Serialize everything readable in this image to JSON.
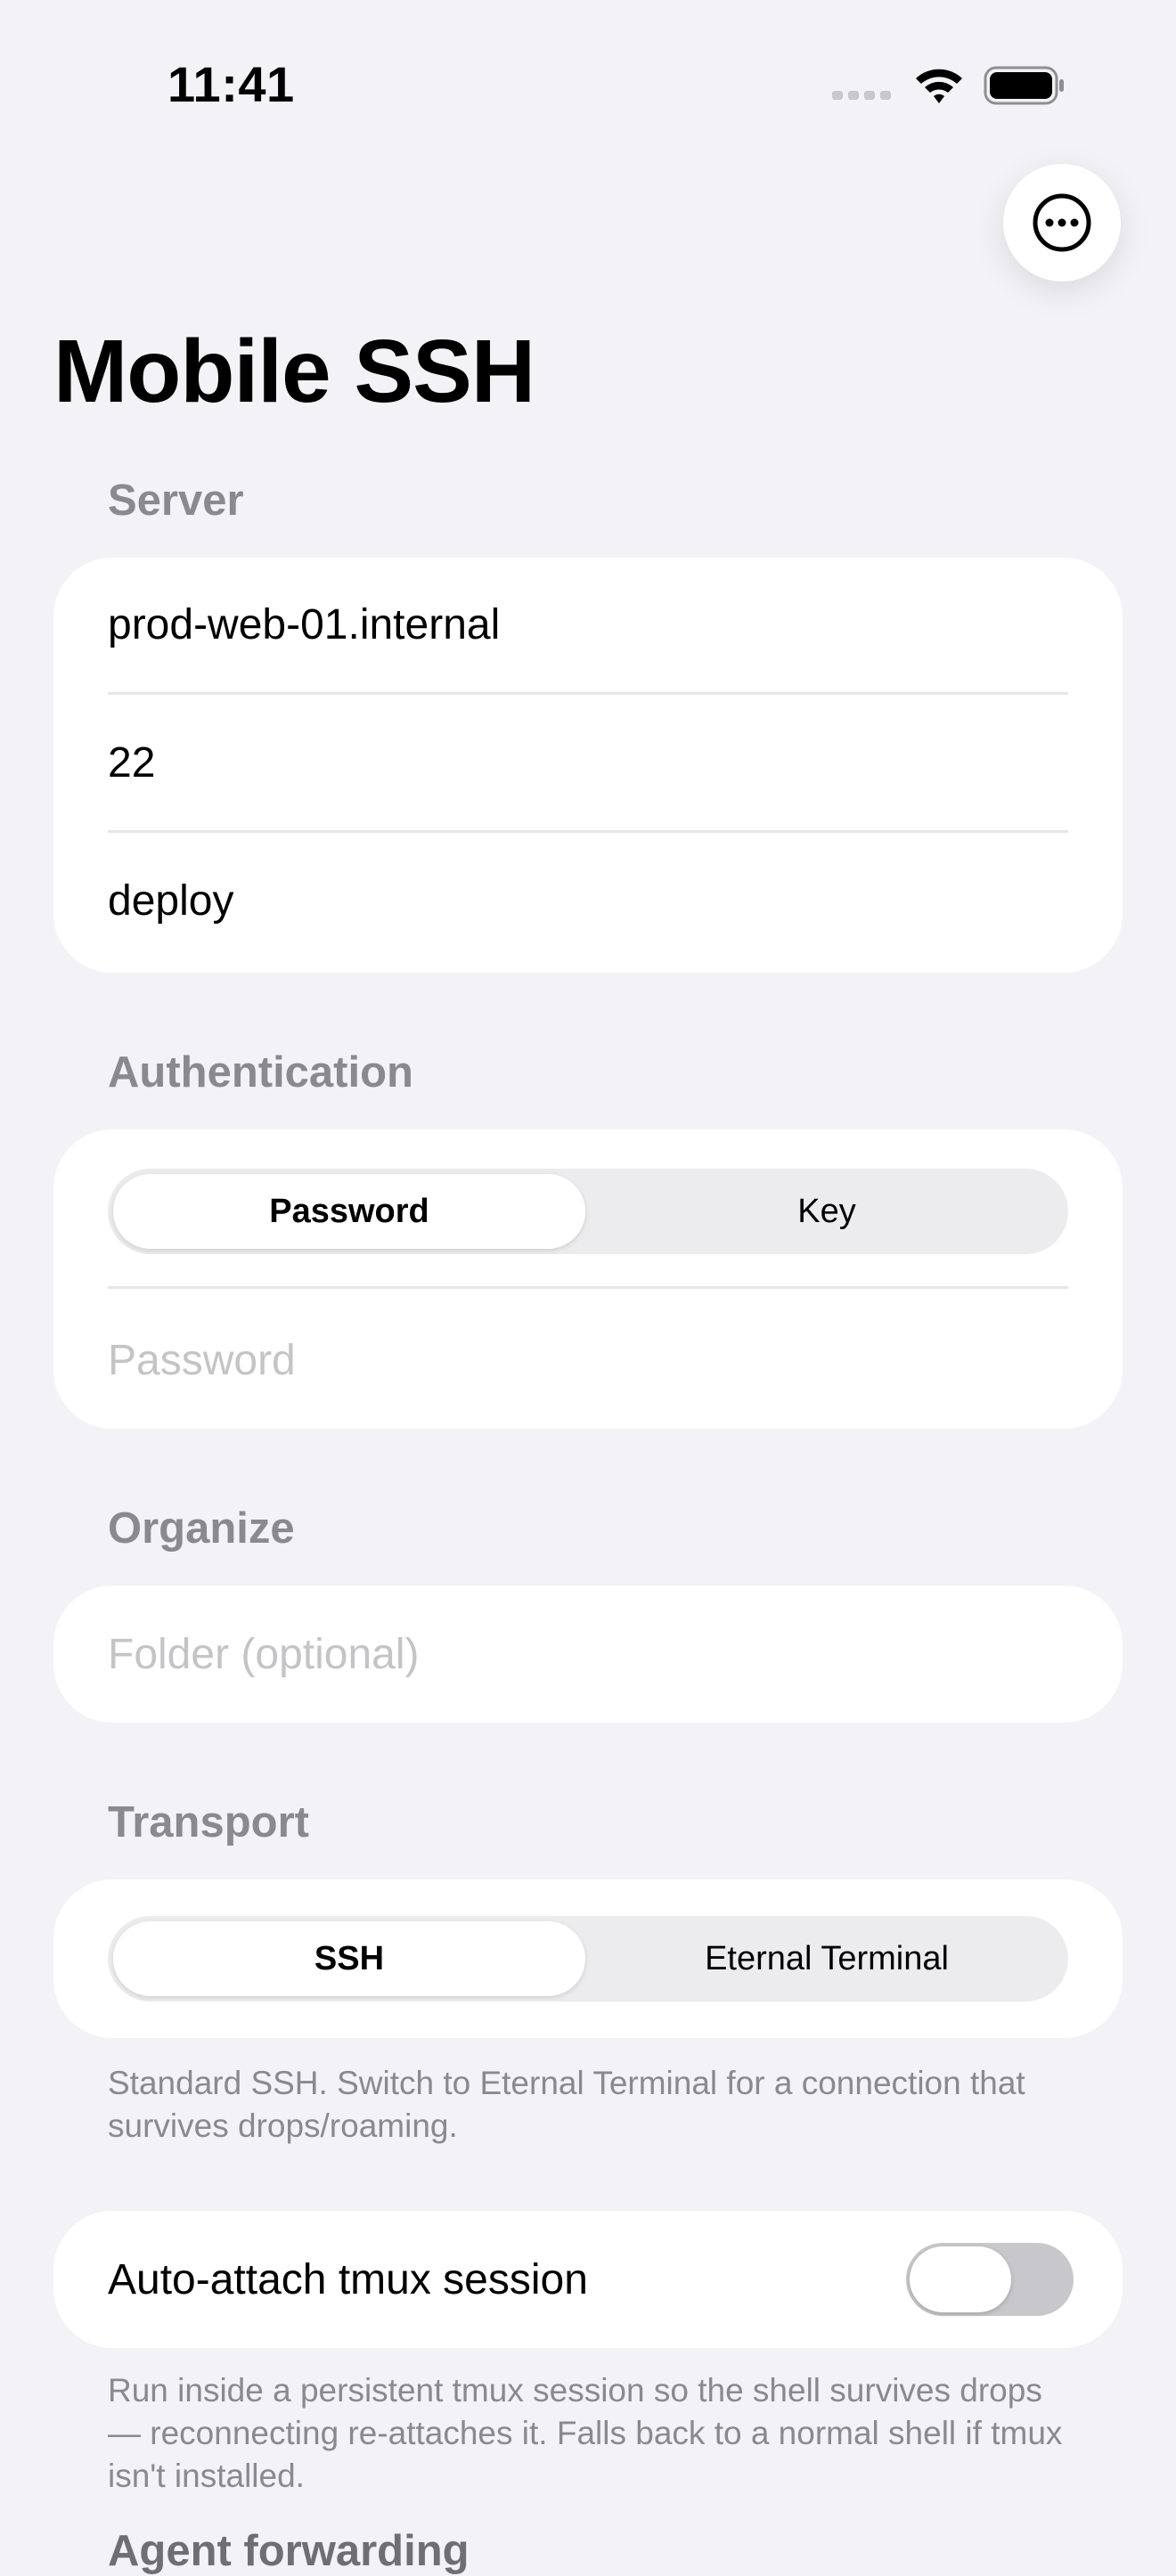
{
  "status_bar": {
    "time": "11:41",
    "icons": [
      "cellular-signal-icon",
      "wifi-icon",
      "battery-icon"
    ]
  },
  "toolbar": {
    "more_icon": "ellipsis-circle-icon"
  },
  "page_title": "Mobile SSH",
  "sections": {
    "server": {
      "header": "Server",
      "host_value": "prod-web-01.internal",
      "port_value": "22",
      "username_value": "deploy"
    },
    "authentication": {
      "header": "Authentication",
      "options": [
        "Password",
        "Key"
      ],
      "selected": "Password",
      "password_placeholder": "Password"
    },
    "organize": {
      "header": "Organize",
      "folder_placeholder": "Folder (optional)"
    },
    "transport": {
      "header": "Transport",
      "options": [
        "SSH",
        "Eternal Terminal"
      ],
      "selected": "SSH",
      "footnote": "Standard SSH. Switch to Eternal Terminal for a connection that survives drops/roaming."
    },
    "tmux": {
      "label": "Auto-attach tmux session",
      "enabled": false,
      "footnote": "Run inside a persistent tmux session so the shell survives drops — reconnecting re-attaches it. Falls back to a normal shell if tmux isn't installed."
    },
    "next_header_partial": "Agent forwarding"
  },
  "colors": {
    "background": "#f2f2f7",
    "card": "#ffffff",
    "secondary_text": "#8a8a8e",
    "placeholder": "#c4c4c7",
    "toggle_off": "#c8c8cc"
  }
}
